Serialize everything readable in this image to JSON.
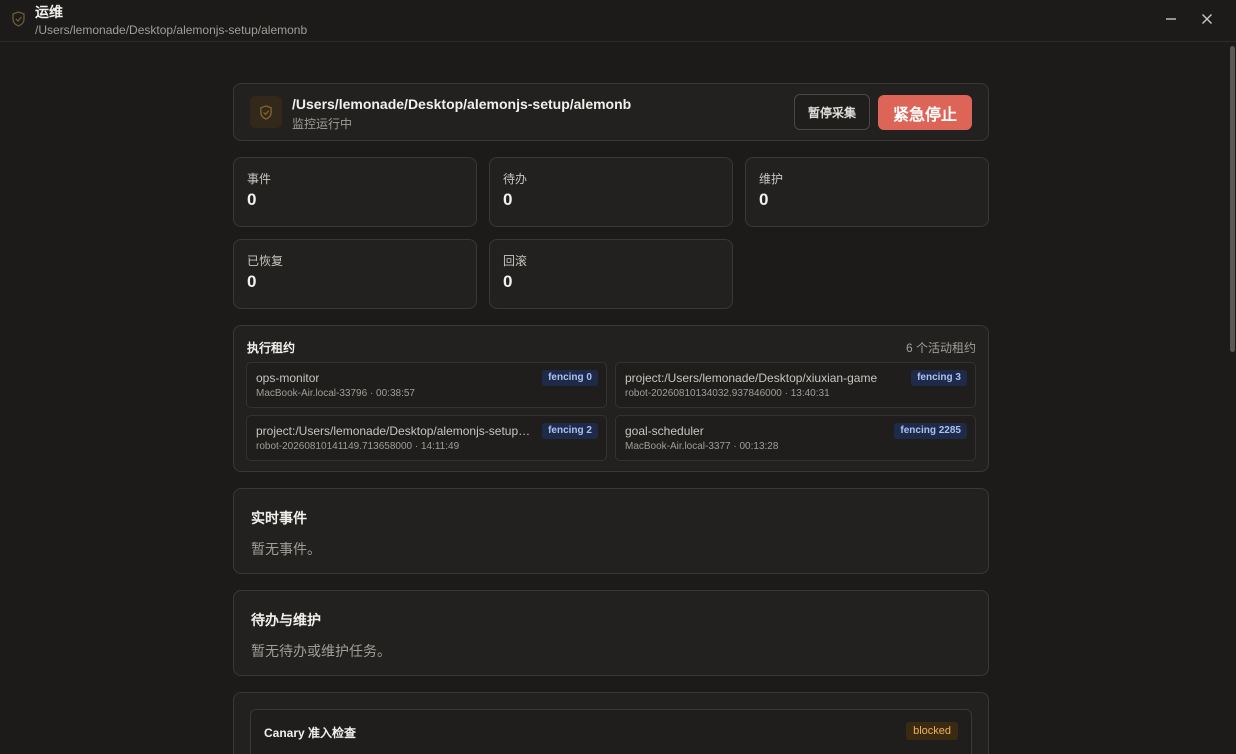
{
  "window": {
    "title": "运维",
    "path": "/Users/lemonade/Desktop/alemonjs-setup/alemonb",
    "min_icon": "minimize-icon",
    "close_icon": "close-icon"
  },
  "header": {
    "title": "/Users/lemonade/Desktop/alemonjs-setup/alemonb",
    "status": "监控运行中",
    "pause_label": "暂停采集",
    "stop_label": "紧急停止",
    "icon": "shield-icon"
  },
  "stats": [
    {
      "label": "事件",
      "value": "0"
    },
    {
      "label": "待办",
      "value": "0"
    },
    {
      "label": "维护",
      "value": "0"
    },
    {
      "label": "已恢复",
      "value": "0"
    },
    {
      "label": "回滚",
      "value": "0"
    }
  ],
  "leases": {
    "title": "执行租约",
    "count": "6 个活动租约",
    "items": [
      {
        "name": "ops-monitor",
        "meta": "MacBook-Air.local-33796 · 00:38:57",
        "fencing": "fencing 0"
      },
      {
        "name": "project:/Users/lemonade/Desktop/xiuxian-game",
        "meta": "robot-20260810134032.937846000 · 13:40:31",
        "fencing": "fencing 3"
      },
      {
        "name": "project:/Users/lemonade/Desktop/alemonjs-setup/alemonb",
        "meta": "robot-20260810141149.713658000 · 14:11:49",
        "fencing": "fencing 2"
      },
      {
        "name": "goal-scheduler",
        "meta": "MacBook-Air.local-3377 · 00:13:28",
        "fencing": "fencing 2285"
      }
    ]
  },
  "realtime": {
    "title": "实时事件",
    "empty": "暂无事件。"
  },
  "todo": {
    "title": "待办与维护",
    "empty": "暂无待办或维护任务。"
  },
  "canary": {
    "title": "Canary 准入检查",
    "status": "blocked"
  },
  "colors": {
    "background": "#1c1b19",
    "panel": "#22211f",
    "stop_button": "#dd6558",
    "fencing_badge_bg": "#1e2a47",
    "blocked_badge_text": "#f0b05a"
  }
}
